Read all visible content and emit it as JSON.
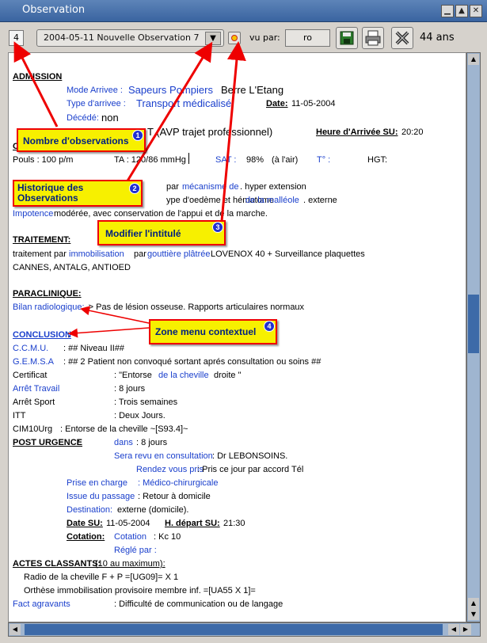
{
  "window": {
    "title": "Observation"
  },
  "toolbar": {
    "observation_count": "4",
    "history_selected": "2004-05-11 Nouvelle Observation 7",
    "vu_par_label": "vu par:",
    "vu_par_value": "ro",
    "age": "44 ans"
  },
  "doc": {
    "admission_title": "ADMISSION",
    "mode_arrivee_label": "Mode Arrivee :",
    "mode_arrivee_value": "Sapeurs Pompiers",
    "mode_arrivee_place": "Berre L'Etang",
    "type_arrivee_label": "Type d'arrivee :",
    "type_arrivee_value": "Transport médicalisé",
    "date_label": "Date:",
    "date_value": "11-05-2004",
    "decede_label": "Décédé:",
    "decede_value": "non",
    "motif_partial": "T (AVP trajet professionnel)",
    "heure_label": "Heure d'Arrivée SU:",
    "heure_value": "20:20",
    "section_c_partial": "C",
    "pouls": "Pouls : 100 p/m",
    "ta": "TA : 120/86 mmHg",
    "sat_label": "SAT :",
    "sat_value": "98%",
    "sat_note": "(à l'air)",
    "temp_label": "T° :",
    "hgt_label": "HGT:",
    "line_par": "par",
    "line_mecanisme": "mécanisme de",
    "line_hyper": ". hyper extension",
    "line_type_oedeme": "ype d'oedème et hématome",
    "line_malleole_de": "de la malléole",
    "line_externe": ". externe",
    "impotence_label": "Impotence",
    "impotence_text": "modérée, avec conservation de l'appui et de la marche.",
    "traitement_title": "TRAITEMENT:",
    "traitement_par": "traitement par",
    "traitement_immob": "immobilisation",
    "traitement_par2": "par",
    "traitement_gouttiere": "gouttière plâtrée",
    "traitement_rest": "LOVENOX 40 + Surveillance plaquettes",
    "traitement_line2": "CANNES, ANTALG, ANTIOED",
    "paraclinique_title": "PARACLINIQUE:",
    "bilan_label": "Bilan radiologique:",
    "bilan_text": "-> Pas de lésion osseuse. Rapports articulaires normaux",
    "conclusion_title": "CONCLUSION",
    "ccmu_label": "C.C.M.U.",
    "ccmu_value": ": ## Niveau II##",
    "gemsa_label": "G.E.M.S.A",
    "gemsa_value": ": ## 2 Patient non convoqué sortant aprés consultation ou soins ##",
    "certificat_label": "Certificat",
    "certificat_value_a": ":    \"Entorse",
    "certificat_value_b": "de la cheville",
    "certificat_value_c": "droite  \"",
    "arret_travail_label": "Arrêt Travail",
    "arret_travail_value": ":    8 jours",
    "arret_sport_label": "Arrêt Sport",
    "arret_sport_value": ":    Trois semaines",
    "itt_label": "ITT",
    "itt_value": ":    Deux Jours.",
    "cim_label": "CIM10Urg",
    "cim_value": ": Entorse de la cheville ~[S93.4]~",
    "post_title": "POST URGENCE",
    "dans_label": "dans",
    "dans_value": ":  8 jours",
    "revu_label": "Sera revu en consultation",
    "revu_value": ":   Dr LEBONSOINS.",
    "rdv_label": "Rendez vous pris",
    "rdv_value": ":   Pris ce jour par accord Tél",
    "prise_label": "Prise en charge",
    "prise_value": ": Médico-chirurgicale",
    "issue_label": "Issue du passage",
    "issue_value": ": Retour à domicile",
    "destination_label": "Destination:",
    "destination_value": "externe (domicile).",
    "date_su_label": "Date SU:",
    "date_su_value": "11-05-2004",
    "depart_label": "H. départ SU:",
    "depart_value": "21:30",
    "cotation_label": "Cotation:",
    "cotation_link": "Cotation",
    "cotation_value": ":  Kc 10",
    "regle_label": "Réglé par :",
    "actes_title": "ACTES CLASSANTS:",
    "actes_note": "(10 au maximum):",
    "acte1": "Radio de la cheville F + P =[UG09]= X 1",
    "acte2": "Orthèse immobilisation provisoire membre inf.  =[UA55 X 1]=",
    "fact_label": "Fact agravants",
    "fact_value": ": Difficulté de communication ou de langage"
  },
  "callouts": [
    {
      "label": "Nombre d'observations",
      "badge": "1"
    },
    {
      "label": "Historique des Observations",
      "badge": "2"
    },
    {
      "label": "Modifier l'intitulé",
      "badge": "3"
    },
    {
      "label": "Zone menu contextuel",
      "badge": "4"
    }
  ],
  "colors": {
    "link_blue": "#1a3fcc",
    "callout_yellow": "#f7f000",
    "arrow_red": "#e00000",
    "title_blue": "#3a64a0"
  }
}
